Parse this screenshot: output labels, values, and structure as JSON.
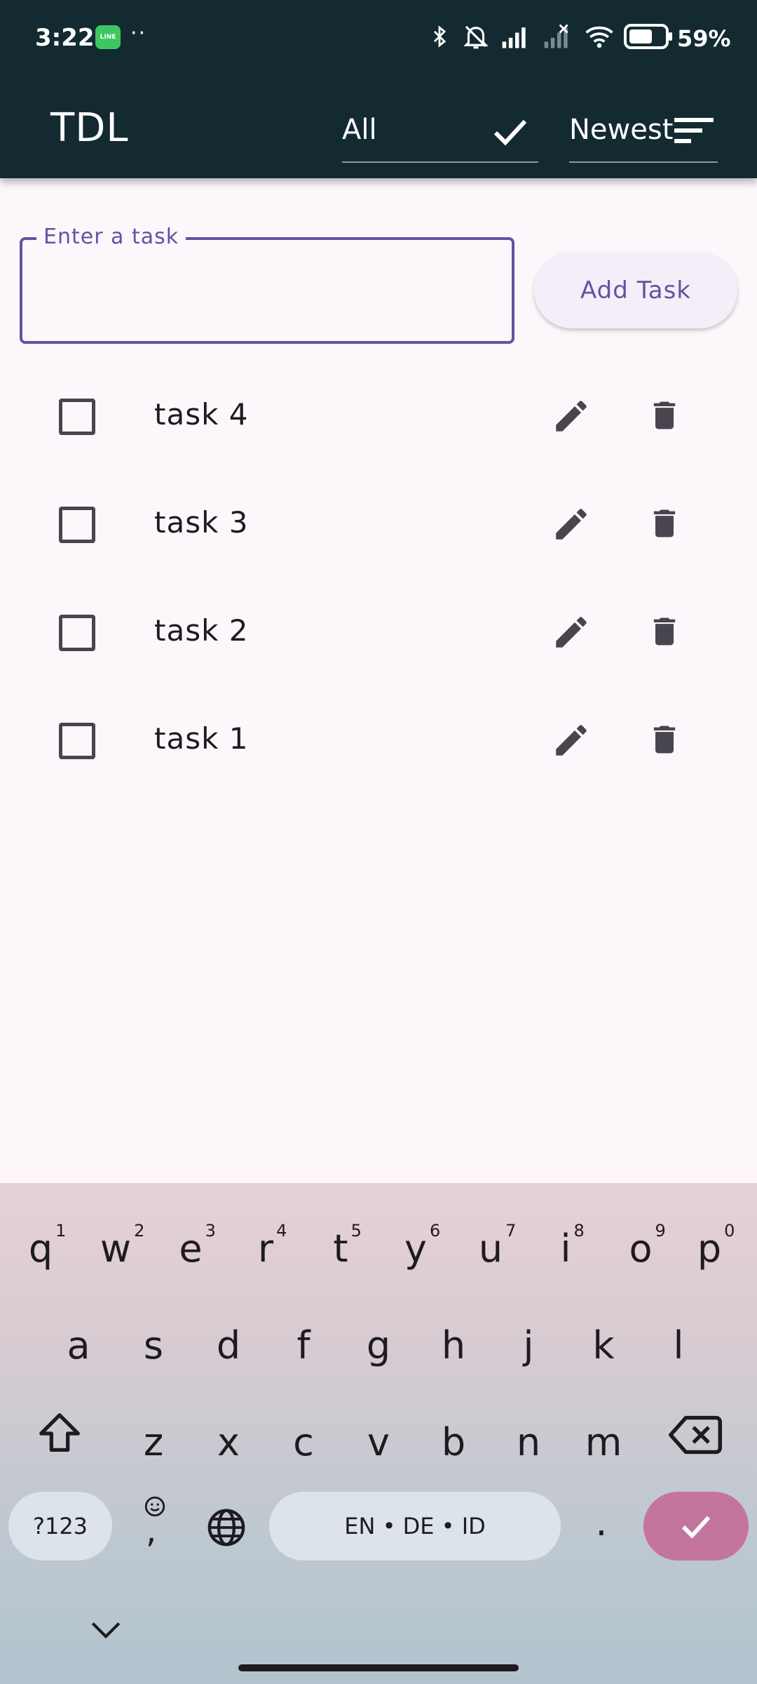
{
  "status_bar": {
    "time": "3:22",
    "line_app_label": "LINE",
    "dots": "··",
    "battery_pct": "59%"
  },
  "app_bar": {
    "title": "TDL",
    "filter": {
      "selected": "All"
    },
    "sort": {
      "selected": "Newest"
    }
  },
  "input": {
    "label": "Enter a task",
    "value": "",
    "add_button_label": "Add Task"
  },
  "tasks": [
    {
      "label": "task 4",
      "checked": false
    },
    {
      "label": "task 3",
      "checked": false
    },
    {
      "label": "task 2",
      "checked": false
    },
    {
      "label": "task 1",
      "checked": false
    }
  ],
  "keyboard": {
    "row1": [
      {
        "key": "q",
        "num": "1"
      },
      {
        "key": "w",
        "num": "2"
      },
      {
        "key": "e",
        "num": "3"
      },
      {
        "key": "r",
        "num": "4"
      },
      {
        "key": "t",
        "num": "5"
      },
      {
        "key": "y",
        "num": "6"
      },
      {
        "key": "u",
        "num": "7"
      },
      {
        "key": "i",
        "num": "8"
      },
      {
        "key": "o",
        "num": "9"
      },
      {
        "key": "p",
        "num": "0"
      }
    ],
    "row2": [
      "a",
      "s",
      "d",
      "f",
      "g",
      "h",
      "j",
      "k",
      "l"
    ],
    "row3": [
      "z",
      "x",
      "c",
      "v",
      "b",
      "n",
      "m"
    ],
    "symbols_label": "?123",
    "emoji_comma": ",",
    "space_label": "EN • DE • ID",
    "period": "."
  },
  "colors": {
    "app_bar": "#132a31",
    "accent": "#6750a4",
    "background": "#fdf7fb",
    "enter_key": "#c4759e"
  }
}
